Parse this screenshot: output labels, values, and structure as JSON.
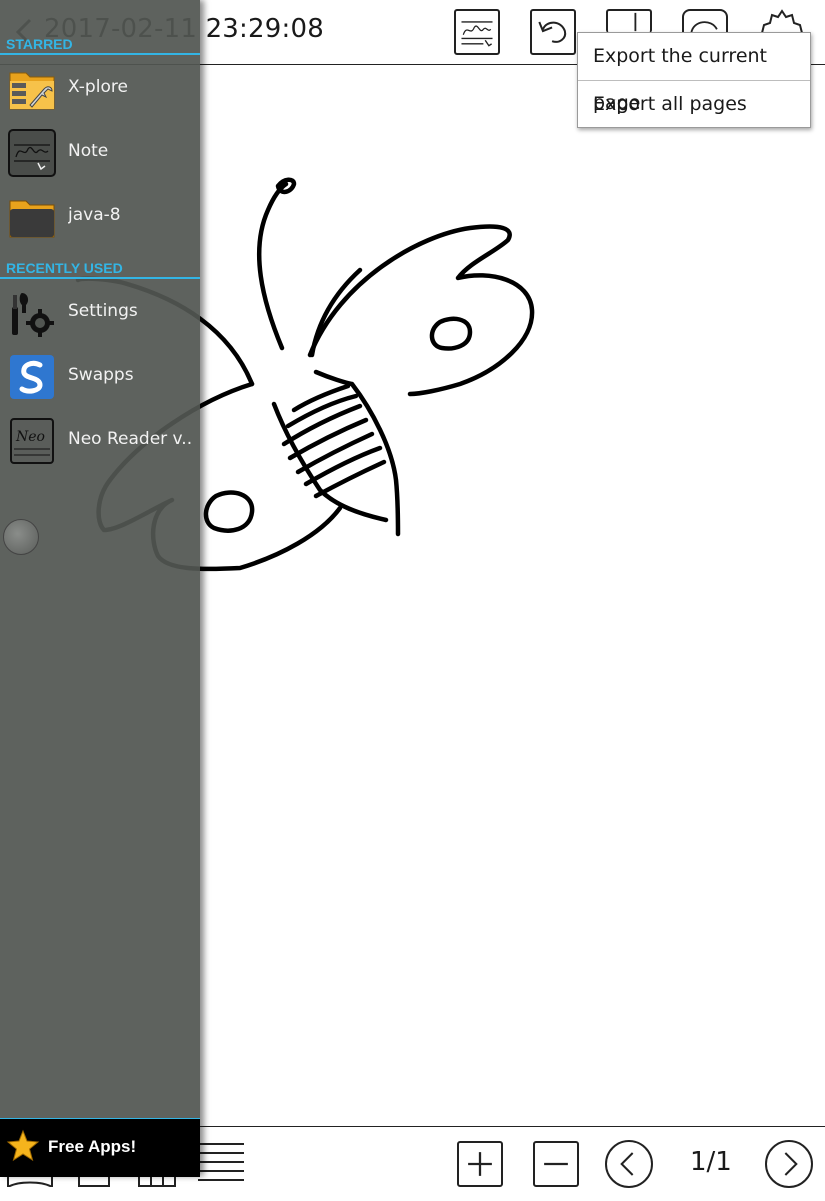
{
  "toolbar": {
    "title": "2017-02-11 23:29:08",
    "icons": [
      "back-icon",
      "handwriting-note-icon",
      "undo-icon",
      "page-icon",
      "rotate-icon",
      "settings-icon"
    ]
  },
  "export_menu": {
    "items": [
      "Export the current page",
      "Export all pages"
    ]
  },
  "sidebar": {
    "starred_header": "STARRED",
    "starred": [
      {
        "label": "X-plore",
        "icon": "xplore-folder-icon"
      },
      {
        "label": "Note",
        "icon": "note-app-icon"
      },
      {
        "label": "java-8",
        "icon": "folder-icon"
      }
    ],
    "recent_header": "RECENTLY USED",
    "recent": [
      {
        "label": "Settings",
        "icon": "settings-tools-icon"
      },
      {
        "label": "Swapps",
        "icon": "swapps-icon"
      },
      {
        "label": "Neo Reader v...",
        "icon": "neo-reader-icon"
      }
    ],
    "free_apps": "Free Apps!"
  },
  "bottombar": {
    "page_indicator": "1/1",
    "icons": [
      "zoom-in-icon",
      "zoom-out-icon",
      "previous-page-icon",
      "next-page-icon"
    ]
  },
  "colors": {
    "accent": "#33b5e5",
    "sidebar_bg": "#525652",
    "ink": "#000000"
  }
}
